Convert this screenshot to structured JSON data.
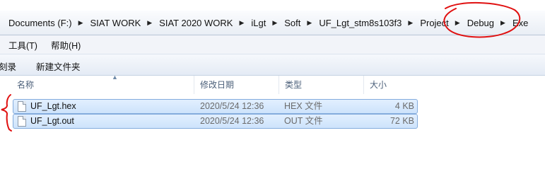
{
  "breadcrumb": [
    "Documents (F:)",
    "SIAT WORK",
    "SIAT 2020 WORK",
    "iLgt",
    "Soft",
    "UF_Lgt_stm8s103f3",
    "Project",
    "Debug",
    "Exe"
  ],
  "menu": {
    "tools": "工具(T)",
    "help": "帮助(H)"
  },
  "toolbar": {
    "partial_item": "刻录",
    "new_folder": "新建文件夹"
  },
  "columns": {
    "name": "名称",
    "date": "修改日期",
    "type": "类型",
    "size": "大小"
  },
  "files": [
    {
      "name": "UF_Lgt.hex",
      "date": "2020/5/24 12:36",
      "type": "HEX 文件",
      "size": "4 KB"
    },
    {
      "name": "UF_Lgt.out",
      "date": "2020/5/24 12:36",
      "type": "OUT 文件",
      "size": "72 KB"
    }
  ],
  "colors": {
    "annotation": "#e01010",
    "selection": "#cde3fb",
    "selection_border": "#84acdd"
  },
  "icons": [
    "breadcrumb-separator-icon",
    "sort-ascending-icon",
    "file-icon"
  ]
}
